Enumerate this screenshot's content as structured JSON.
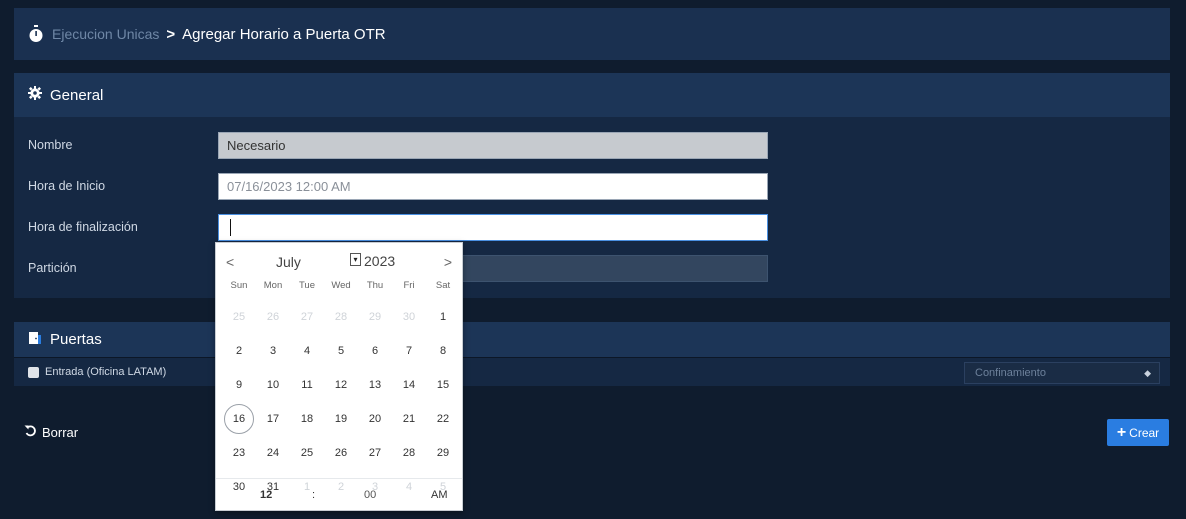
{
  "header": {
    "breadcrumb_root": "Ejecucion Unicas",
    "separator": ">",
    "title": "Agregar Horario a Puerta OTR"
  },
  "general": {
    "heading": "General",
    "nombre_label": "Nombre",
    "nombre_value": "Necesario",
    "inicio_label": "Hora de Inicio",
    "inicio_value": "07/16/2023 12:00 AM",
    "fin_label": "Hora de finalización",
    "fin_value": "",
    "particion_label": "Partición"
  },
  "puertas": {
    "heading": "Puertas",
    "door_label": "Entrada (Oficina LATAM)",
    "mode_value": "Confinamiento"
  },
  "actions": {
    "borrar": "Borrar",
    "crear": "Crear"
  },
  "calendar": {
    "prev": "<",
    "next": ">",
    "month": "July",
    "year": "2023",
    "dow": [
      "Sun",
      "Mon",
      "Tue",
      "Wed",
      "Thu",
      "Fri",
      "Sat"
    ],
    "days": [
      {
        "d": "25",
        "m": true
      },
      {
        "d": "26",
        "m": true
      },
      {
        "d": "27",
        "m": true
      },
      {
        "d": "28",
        "m": true
      },
      {
        "d": "29",
        "m": true
      },
      {
        "d": "30",
        "m": true
      },
      {
        "d": "1"
      },
      {
        "d": "2"
      },
      {
        "d": "3"
      },
      {
        "d": "4"
      },
      {
        "d": "5"
      },
      {
        "d": "6"
      },
      {
        "d": "7"
      },
      {
        "d": "8"
      },
      {
        "d": "9"
      },
      {
        "d": "10"
      },
      {
        "d": "11"
      },
      {
        "d": "12"
      },
      {
        "d": "13"
      },
      {
        "d": "14"
      },
      {
        "d": "15"
      },
      {
        "d": "16",
        "t": true
      },
      {
        "d": "17"
      },
      {
        "d": "18"
      },
      {
        "d": "19"
      },
      {
        "d": "20"
      },
      {
        "d": "21"
      },
      {
        "d": "22"
      },
      {
        "d": "23"
      },
      {
        "d": "24"
      },
      {
        "d": "25"
      },
      {
        "d": "26"
      },
      {
        "d": "27"
      },
      {
        "d": "28"
      },
      {
        "d": "29"
      },
      {
        "d": "30"
      },
      {
        "d": "31"
      },
      {
        "d": "1",
        "m": true
      },
      {
        "d": "2",
        "m": true
      },
      {
        "d": "3",
        "m": true
      },
      {
        "d": "4",
        "m": true
      },
      {
        "d": "5",
        "m": true
      }
    ],
    "time": {
      "hour": "12",
      "colon": ":",
      "minute": "00",
      "ampm": "AM"
    }
  },
  "colors": {
    "accent": "#2a7de1",
    "background": "#0f1c2e",
    "panel": "#152843"
  }
}
